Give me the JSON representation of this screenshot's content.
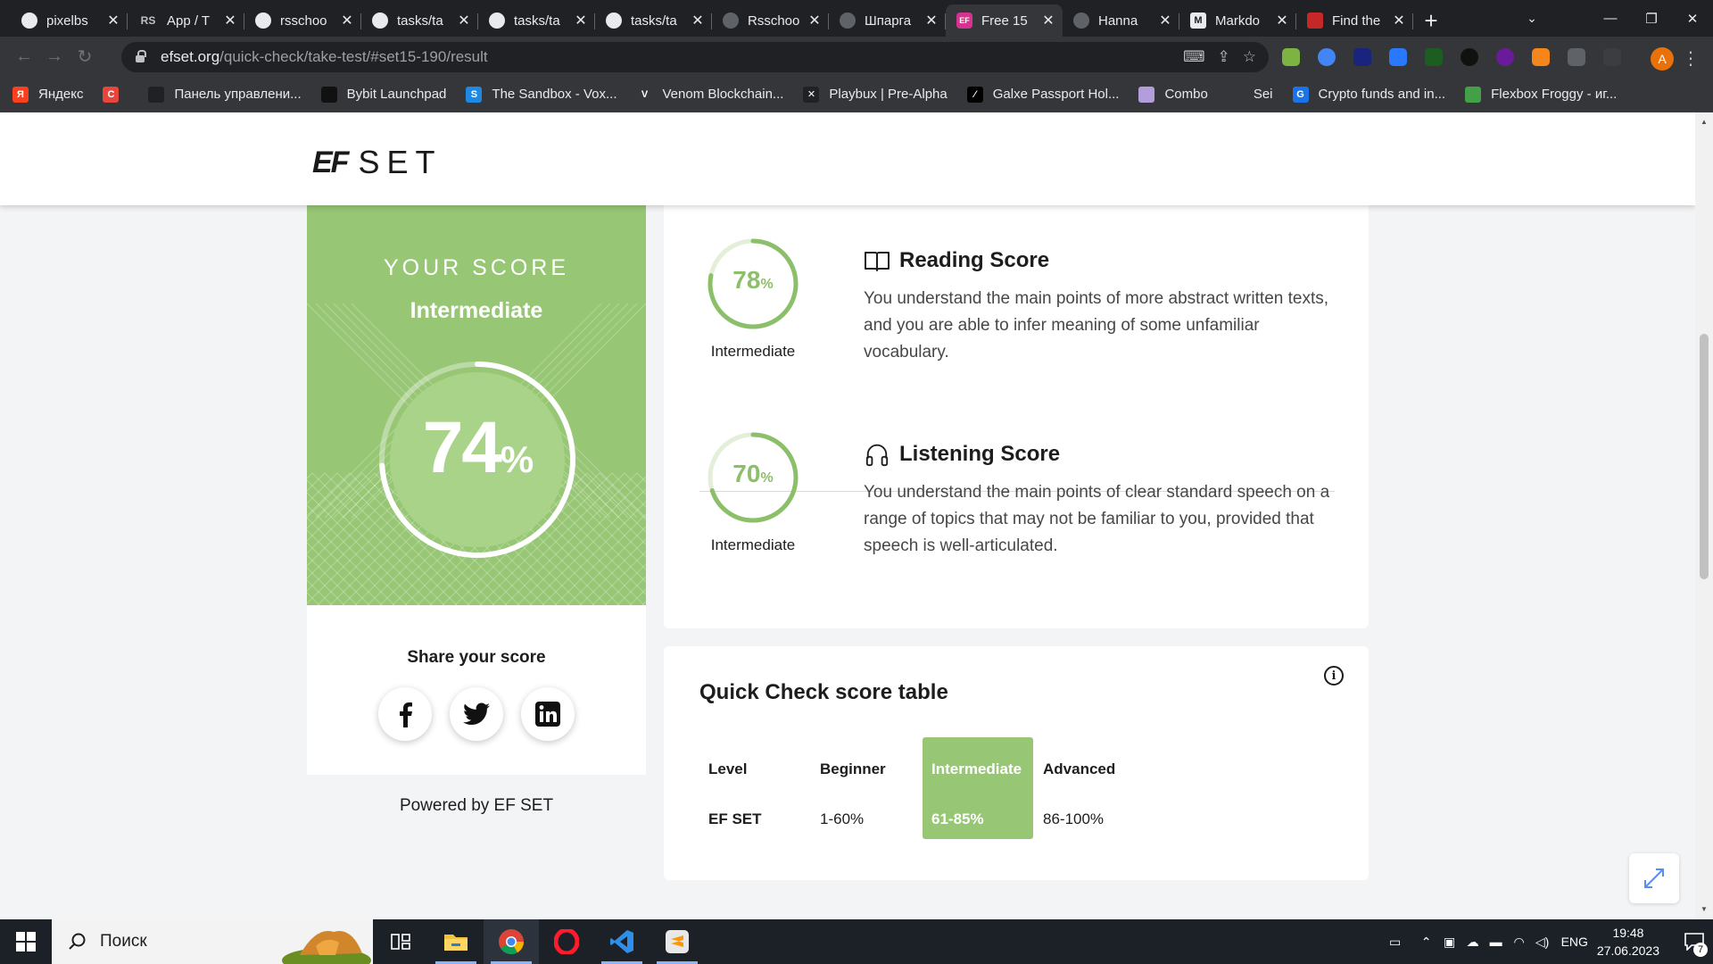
{
  "browser": {
    "tabs": [
      {
        "title": "pixelbs",
        "icon": "github-icon"
      },
      {
        "title": "App / T",
        "icon": "rs-icon"
      },
      {
        "title": "rsschoo",
        "icon": "github-icon"
      },
      {
        "title": "tasks/ta",
        "icon": "github-icon"
      },
      {
        "title": "tasks/ta",
        "icon": "github-icon"
      },
      {
        "title": "tasks/ta",
        "icon": "github-icon"
      },
      {
        "title": "Rsschoo",
        "icon": "globe-icon"
      },
      {
        "title": "Шпарга",
        "icon": "globe-icon"
      },
      {
        "title": "Free 15",
        "icon": "ef-icon",
        "active": true
      },
      {
        "title": "Hanna",
        "icon": "globe-icon"
      },
      {
        "title": "Markdo",
        "icon": "m-icon"
      },
      {
        "title": "Find the",
        "icon": "page-icon"
      }
    ],
    "url_domain": "efset.org",
    "url_path": "/quick-check/take-test/#set15-190/result",
    "profile_initial": "A",
    "bookmarks": [
      {
        "label": "Яндекс",
        "icon_color": "#fc3f1d",
        "glyph": "Я"
      },
      {
        "label": "",
        "icon_color": "#e8453c",
        "glyph": "C"
      },
      {
        "label": "Панель управлени...",
        "icon_color": "#202124",
        "glyph": ""
      },
      {
        "label": "Bybit Launchpad",
        "icon_color": "#111111",
        "glyph": ""
      },
      {
        "label": "The Sandbox - Vox...",
        "icon_color": "#1e88e5",
        "glyph": "S"
      },
      {
        "label": "Venom Blockchain...",
        "icon_color": "#35363a",
        "glyph": "V"
      },
      {
        "label": "Playbux | Pre-Alpha",
        "icon_color": "#202124",
        "glyph": "✕"
      },
      {
        "label": "Galxe Passport Hol...",
        "icon_color": "#000000",
        "glyph": "⁄"
      },
      {
        "label": "Combo",
        "icon_color": "#b39ddb",
        "glyph": ""
      },
      {
        "label": "Sei",
        "icon_color": "#35363a",
        "glyph": ""
      },
      {
        "label": "Crypto funds and in...",
        "icon_color": "#1a73e8",
        "glyph": "G"
      },
      {
        "label": "Flexbox Froggy - иг...",
        "icon_color": "#43a047",
        "glyph": ""
      }
    ]
  },
  "page": {
    "logo_ef": "EF",
    "logo_set": "SET",
    "score": {
      "heading": "YOUR SCORE",
      "level": "Intermediate",
      "percent": 74,
      "percent_symbol": "%"
    },
    "share": {
      "title": "Share your score",
      "buttons": [
        "facebook-icon",
        "twitter-icon",
        "linkedin-icon"
      ]
    },
    "powered": "Powered by EF SET",
    "skills": [
      {
        "title": "Reading Score",
        "icon": "book-icon",
        "percent": 78,
        "level": "Intermediate",
        "description": "You understand the main points of more abstract written texts, and you are able to infer meaning of some unfamiliar vocabulary."
      },
      {
        "title": "Listening Score",
        "icon": "headphones-icon",
        "percent": 70,
        "level": "Intermediate",
        "description": "You understand the main points of clear standard speech on a range of topics that may not be familiar to you, provided that speech is well-articulated."
      }
    ],
    "score_table": {
      "title": "Quick Check score table",
      "headers": [
        "Level",
        "Beginner",
        "Intermediate",
        "Advanced"
      ],
      "row": [
        "EF SET",
        "1-60%",
        "61-85%",
        "86-100%"
      ],
      "highlighted_column": "Intermediate"
    },
    "colors": {
      "accent_green": "#97c675",
      "ring_green": "#8cbf6a"
    }
  },
  "taskbar": {
    "search_placeholder": "Поиск",
    "apps": [
      "task-view-icon",
      "file-explorer-icon",
      "chrome-icon",
      "opera-icon",
      "vscode-icon",
      "sublime-icon"
    ],
    "language": "ENG",
    "time": "19:48",
    "date": "27.06.2023",
    "notifications": "7"
  }
}
